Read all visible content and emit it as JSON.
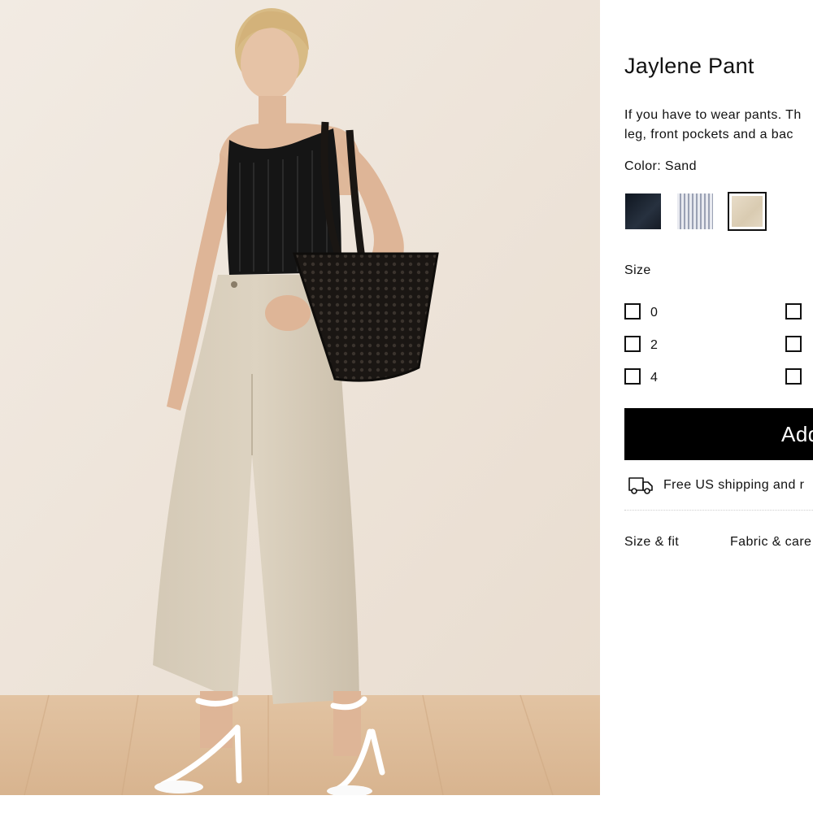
{
  "product": {
    "title": "Jaylene Pant",
    "description_lines": [
      "If you have to wear pants. Th",
      "leg, front pockets and a bac"
    ],
    "color_label": "Color: Sand"
  },
  "swatches": [
    {
      "name": "Navy",
      "color": "#1b2330",
      "selected": false
    },
    {
      "name": "Stripe",
      "color": "#c9ccd6",
      "selected": false
    },
    {
      "name": "Sand",
      "color": "#e2d5c0",
      "selected": true
    }
  ],
  "size": {
    "label": "Size",
    "options": [
      "0",
      "2",
      "4",
      "",
      "",
      ""
    ]
  },
  "add_button_label": "Add",
  "shipping": {
    "text": "Free US shipping and r",
    "icon": "truck-icon"
  },
  "tabs": [
    "Size & fit",
    "Fabric & care"
  ],
  "colors": {
    "accent": "#000000",
    "background": "#ffffff",
    "photo_backdrop": "#efe6dc"
  }
}
